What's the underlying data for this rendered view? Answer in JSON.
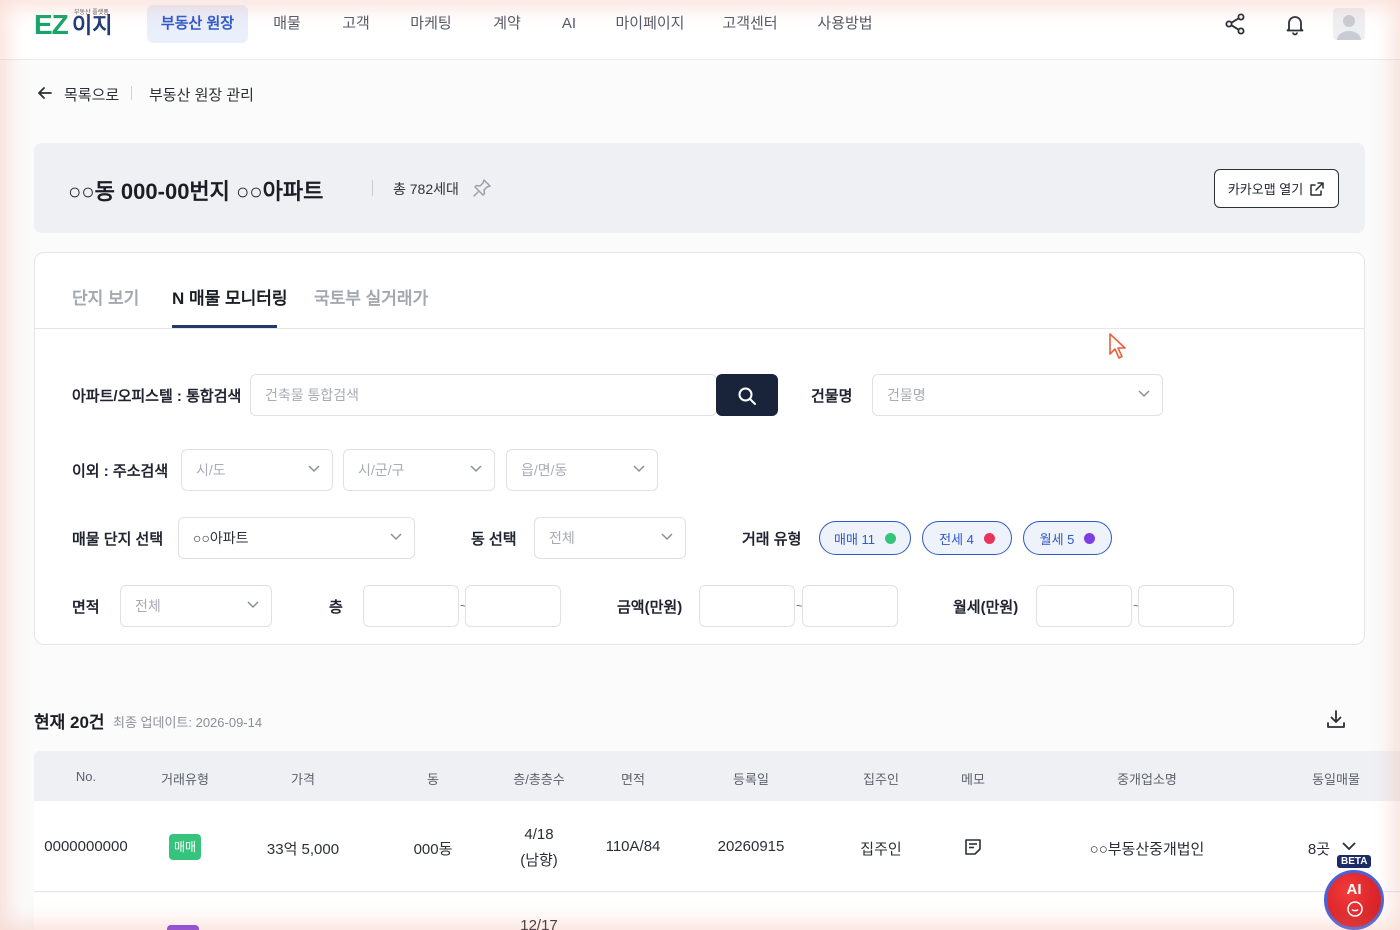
{
  "brand": {
    "logo_main": "EZ",
    "logo_sub": "이지",
    "logo_tagline": "부동산 플랫폼"
  },
  "nav": {
    "items": [
      "부동산 원장",
      "매물",
      "고객",
      "마케팅",
      "계약",
      "AI",
      "마이페이지",
      "고객센터",
      "사용방법"
    ],
    "active": "부동산 원장"
  },
  "breadcrumb": {
    "back_label": "목록으로",
    "current": "부동산 원장 관리"
  },
  "hero": {
    "title": "○○동 000-00번지 ○○아파트",
    "count": "총 782세대",
    "kakao_button": "카카오맵 열기"
  },
  "tabs": {
    "items": [
      "단지 보기",
      "N 매물 모니터링",
      "국토부 실거래가"
    ],
    "active": "N 매물 모니터링"
  },
  "filters": {
    "integrated_label": "아파트/오피스텔 : 통합검색",
    "integrated_placeholder": "건축물 통합검색",
    "building_label": "건물명",
    "building_placeholder": "건물명",
    "address_label": "이외 : 주소검색",
    "sido_placeholder": "시/도",
    "sigungu_placeholder": "시/군/구",
    "dong_placeholder": "읍/면/동",
    "complex_label": "매물 단지 선택",
    "complex_value": "○○아파트",
    "dong_select_label": "동 선택",
    "dong_select_value": "전체",
    "deal_type_label": "거래 유형",
    "deal_chips": [
      {
        "label": "매매 11",
        "color": "#36c37c"
      },
      {
        "label": "전세 4",
        "color": "#e8345a"
      },
      {
        "label": "월세 5",
        "color": "#7b3fe4"
      }
    ],
    "area_label": "면적",
    "area_value": "전체",
    "floor_label": "층",
    "price_label": "금액(만원)",
    "rent_label": "월세(만원)",
    "range_separator": "~"
  },
  "results": {
    "title": "현재 20건",
    "updated": "최종 업데이트: 2026-09-14"
  },
  "table": {
    "columns": [
      "No.",
      "거래유형",
      "가격",
      "동",
      "층/총층수",
      "면적",
      "등록일",
      "집주인",
      "메모",
      "중개업소명",
      "동일매물"
    ],
    "rows": [
      {
        "no": "0000000000",
        "type": "매매",
        "price": "33억 5,000",
        "dong": "000동",
        "floor": "4/18",
        "floor_dir": "(남향)",
        "area": "110A/84",
        "date": "20260915",
        "owner": "집주인",
        "agency": "○○부동산중개법인",
        "same": "8곳"
      },
      {
        "floor": "12/17"
      }
    ]
  },
  "fab": {
    "label": "AI",
    "badge": "BETA"
  },
  "colors": {
    "accent": "#2f58c8",
    "dark": "#19243a",
    "brand_green": "#16a46a",
    "brand_navy": "#1f3c7a"
  }
}
